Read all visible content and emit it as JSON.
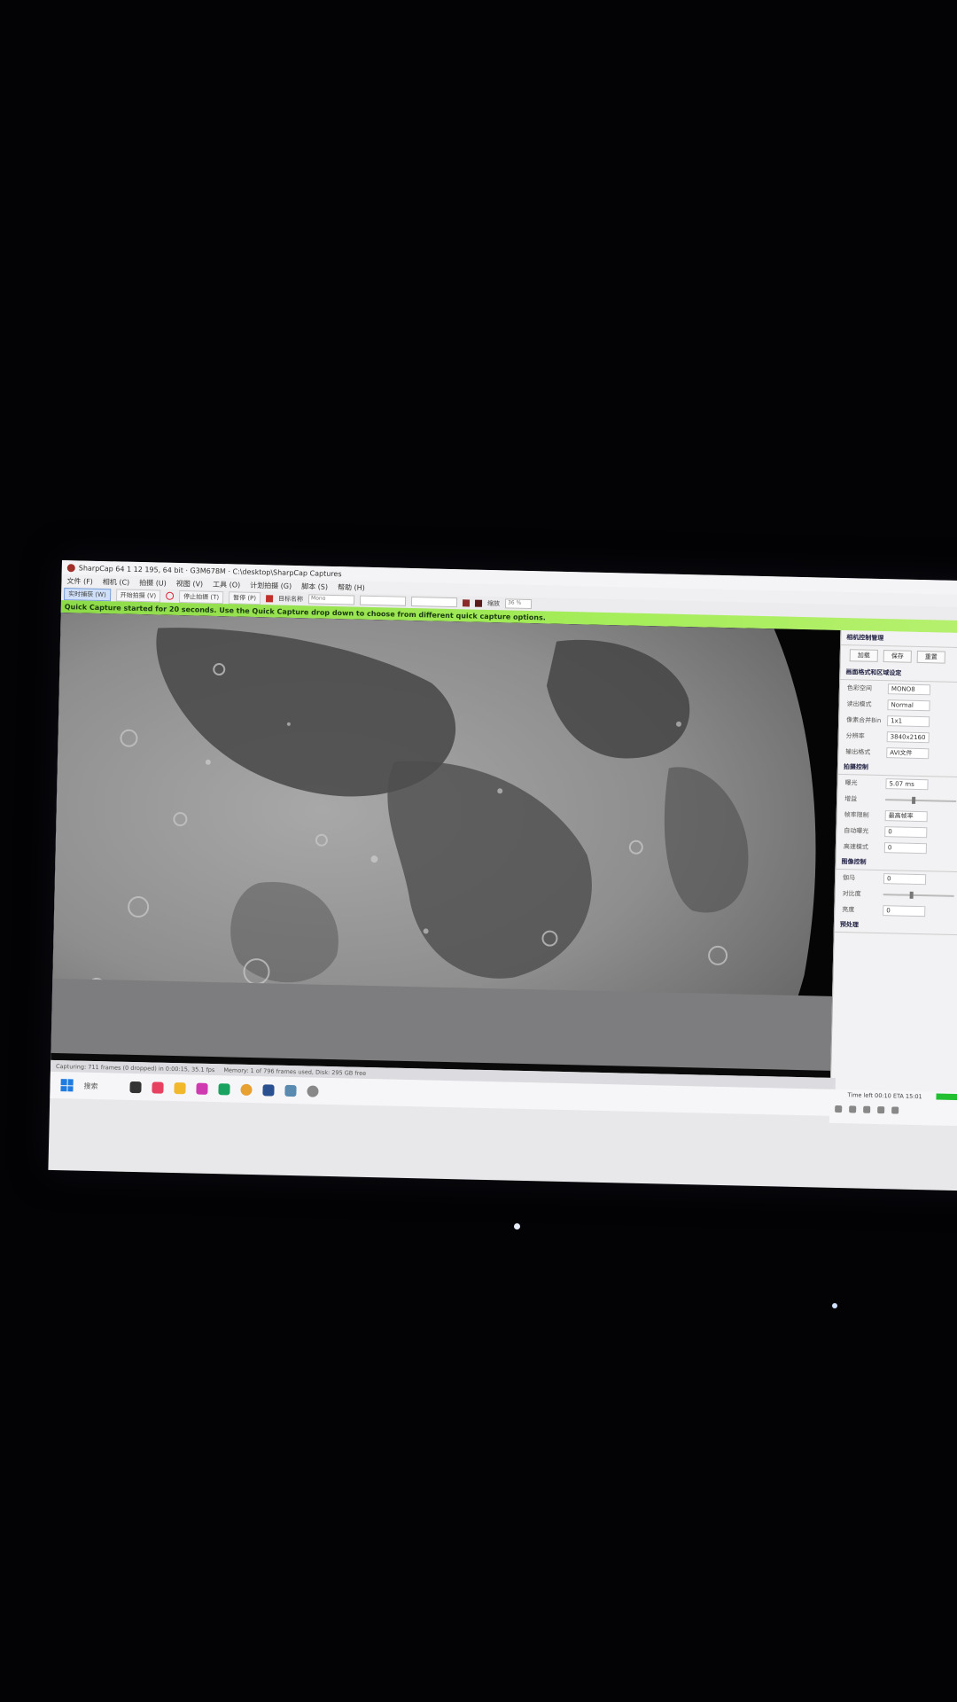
{
  "window": {
    "title": "SharpCap 64 1 12 195, 64 bit · G3M678M · C:\\desktop\\SharpCap Captures"
  },
  "menu": {
    "items": [
      "文件 (F)",
      "相机 (C)",
      "拍摄 (U)",
      "视图 (V)",
      "工具 (O)",
      "计划拍摄 (G)",
      "脚本 (S)",
      "帮助 (H)"
    ]
  },
  "toolbar": {
    "capture_label": "实时捕获 (W)",
    "start_label": "开始拍摄 (V)",
    "stop_label": "停止拍摄 (T)",
    "pause_label": "暂停 (P)",
    "target_label": "目标名称",
    "format_placeholder": "Mono",
    "zoom_label": "缩放",
    "zoom_value": "36 %"
  },
  "notice": {
    "text": "Quick Capture started for 20 seconds. Use the Quick Capture drop down to choose from different quick capture options."
  },
  "panel": {
    "header": "相机控制管理",
    "buttons": [
      "加载",
      "保存",
      "重置"
    ],
    "section1": "画面格式和区域设定",
    "rows1": [
      {
        "label": "色彩空间",
        "value": "MONO8"
      },
      {
        "label": "读出模式",
        "value": "Normal"
      },
      {
        "label": "像素合并Bin",
        "value": "1x1"
      },
      {
        "label": "分辨率",
        "value": "3840x2160"
      },
      {
        "label": "输出格式",
        "value": "AVI文件"
      }
    ],
    "section2": "拍摄控制",
    "rows2": [
      {
        "label": "曝光",
        "value": "5.07 ms"
      },
      {
        "label": "增益",
        "value": ""
      },
      {
        "label": "帧率限制",
        "value": "最高帧率"
      },
      {
        "label": "自动曝光",
        "value": "0"
      },
      {
        "label": "高速模式",
        "value": "0"
      }
    ],
    "section3": "图像控制",
    "rows3": [
      {
        "label": "伽马",
        "value": "0"
      },
      {
        "label": "对比度",
        "value": ""
      },
      {
        "label": "亮度",
        "value": "0"
      }
    ],
    "section4": "预处理"
  },
  "statusbar": {
    "left": "Capturing: 711 frames (0 dropped) in 0:00:15, 35.1 fps",
    "memory": "Memory: 1 of 796 frames used, Disk: 295 GB free"
  },
  "taskbar": {
    "search": "搜索"
  },
  "tray": {
    "time_left": "Time left 00:10 ETA 15:01"
  }
}
